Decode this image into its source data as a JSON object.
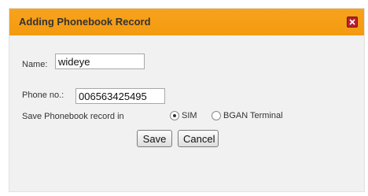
{
  "dialog": {
    "title": "Adding Phonebook Record"
  },
  "form": {
    "name_label": "Name:",
    "name_value": "wideye",
    "phone_label": "Phone no.:",
    "phone_value": "006563425495",
    "save_in_label": "Save Phonebook record in",
    "save_options": [
      {
        "label": "SIM",
        "selected": true
      },
      {
        "label": "BGAN Terminal",
        "selected": false
      }
    ]
  },
  "buttons": {
    "save": "Save",
    "cancel": "Cancel"
  },
  "icons": {
    "close": "close-icon"
  },
  "colors": {
    "titlebar": "#f39a10",
    "close_button": "#b8202b"
  }
}
